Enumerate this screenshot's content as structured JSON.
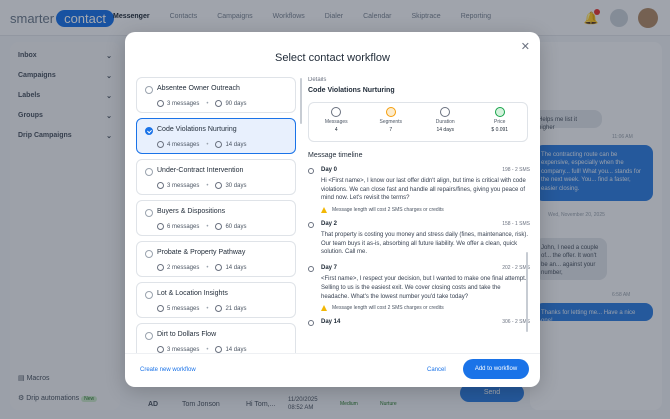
{
  "app": {
    "logo_a": "smarter",
    "logo_b": "contact"
  },
  "nav": [
    "Messenger",
    "Contacts",
    "Campaigns",
    "Workflows",
    "Dialer",
    "Calendar",
    "Skiptrace",
    "Reporting"
  ],
  "sidebar": {
    "items": [
      {
        "label": "Inbox"
      },
      {
        "label": "Campaigns"
      },
      {
        "label": "Labels"
      },
      {
        "label": "Groups"
      },
      {
        "label": "Drip Campaigns"
      }
    ],
    "macros": "Macros",
    "drip_automations": "Drip automations",
    "drip_badge": "New"
  },
  "background": {
    "bubble1": "The contracting route can be expensive, especially when the company... full! What you... stands for the next week. You... find a faster, easier closing.",
    "bubble_gray": "John, I need a couple of... the offer. It won't be an... against your number,",
    "bubble2": "Thanks for letting me... Have a nice one!",
    "ts1": "11:06 AM",
    "ts2": "Wed, November 20, 2025",
    "ts3": "6:58 AM",
    "gray_top": "Helps me list it higher",
    "row_initials": "AD",
    "row_name": "Tom Jonson",
    "row_hi": "Hi Tom,...",
    "row_date": "11/20/2025",
    "row_time": "08:52 AM",
    "row_medium": "Medium",
    "row_nurture": "Nurture",
    "send": "Send"
  },
  "modal": {
    "title": "Select contact workflow",
    "workflows": [
      {
        "name": "Absentee Owner Outreach",
        "messages": "3 messages",
        "days": "90 days",
        "selected": false
      },
      {
        "name": "Code Violations Nurturing",
        "messages": "4 messages",
        "days": "14 days",
        "selected": true
      },
      {
        "name": "Under-Contract Intervention",
        "messages": "3 messages",
        "days": "30 days",
        "selected": false
      },
      {
        "name": "Buyers & Dispositions",
        "messages": "6 messages",
        "days": "60 days",
        "selected": false
      },
      {
        "name": "Probate & Property Pathway",
        "messages": "2 messages",
        "days": "14 days",
        "selected": false
      },
      {
        "name": "Lot & Location Insights",
        "messages": "5 messages",
        "days": "21 days",
        "selected": false
      },
      {
        "name": "Dirt to Dollars Flow",
        "messages": "3 messages",
        "days": "14 days",
        "selected": false
      }
    ],
    "details": {
      "label": "Details",
      "name": "Code Violations Nurturing",
      "stats": [
        {
          "label": "Messages",
          "value": "4",
          "icon": "chat-icon",
          "color": "#6b7280"
        },
        {
          "label": "Segments",
          "value": "7",
          "icon": "segments-icon",
          "color": "#f59e0b"
        },
        {
          "label": "Duration",
          "value": "14 days",
          "icon": "clock-icon",
          "color": "#6b7280"
        },
        {
          "label": "Price",
          "value": "$ 0.091",
          "icon": "dollar-icon",
          "color": "#16a34a"
        }
      ],
      "timeline_title": "Message timeline",
      "days": [
        {
          "day": "Day 0",
          "sms": "198 - 2 SMS",
          "text": "Hi <First name>, I know our last offer didn't align, but time is critical with code violations. We can close fast and handle all repairs/fines, giving you peace of mind now. Let's revisit the terms?",
          "warn": "Message length will cost 2 SMS charges or credits"
        },
        {
          "day": "Day 2",
          "sms": "158 - 1 SMS",
          "text": "That property is costing you money and stress daily (fines, maintenance, risk). Our team buys it as-is, absorbing all future liability. We offer a clean, quick solution. Call me.",
          "warn": ""
        },
        {
          "day": "Day 7",
          "sms": "202 - 2 SMS",
          "text": "<First name>, I respect your decision, but I wanted to make one final attempt. Selling to us is the easiest exit. We cover closing costs and take the headache. What's the lowest number you'd take today?",
          "warn": "Message length will cost 2 SMS charges or credits"
        },
        {
          "day": "Day 14",
          "sms": "306 - 2 SMS",
          "text": "",
          "warn": ""
        }
      ]
    },
    "footer": {
      "create": "Create new workflow",
      "cancel": "Cancel",
      "add": "Add to workflow"
    }
  }
}
